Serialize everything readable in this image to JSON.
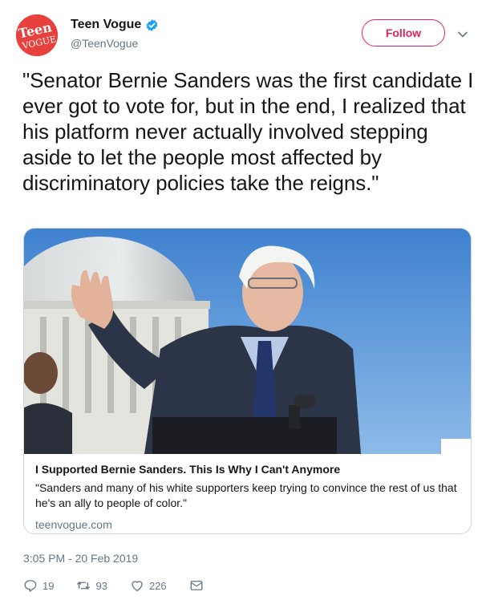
{
  "account": {
    "display_name": "Teen Vogue",
    "handle": "@TeenVogue",
    "avatar_text_top": "Teen",
    "avatar_text_bottom": "VOGUE",
    "verified": true
  },
  "follow_label": "Follow",
  "tweet": {
    "text": "\"Senator Bernie Sanders was the first candidate I ever got to vote for, but in the end, I realized that his platform never actually involved stepping aside to let the people most affected by discriminatory policies take the reigns.\""
  },
  "card": {
    "title": "I Supported Bernie Sanders. This Is Why I Can't Anymore",
    "description": "\"Sanders and many of his white supporters keep trying to convince the rest of us that he's an ally to people of color.\"",
    "domain": "teenvogue.com"
  },
  "timestamp": "3:05 PM - 20 Feb 2019",
  "actions": {
    "replies": "19",
    "retweets": "93",
    "likes": "226"
  },
  "icons": {
    "verified": "verified-badge-icon",
    "caret": "chevron-down-icon",
    "reply": "reply-icon",
    "retweet": "retweet-icon",
    "like": "heart-icon",
    "message": "direct-message-icon"
  },
  "colors": {
    "brand_red": "#e8403c",
    "follow_accent": "#e0245e",
    "verified_blue": "#1da1f2",
    "secondary_text": "#657786"
  }
}
